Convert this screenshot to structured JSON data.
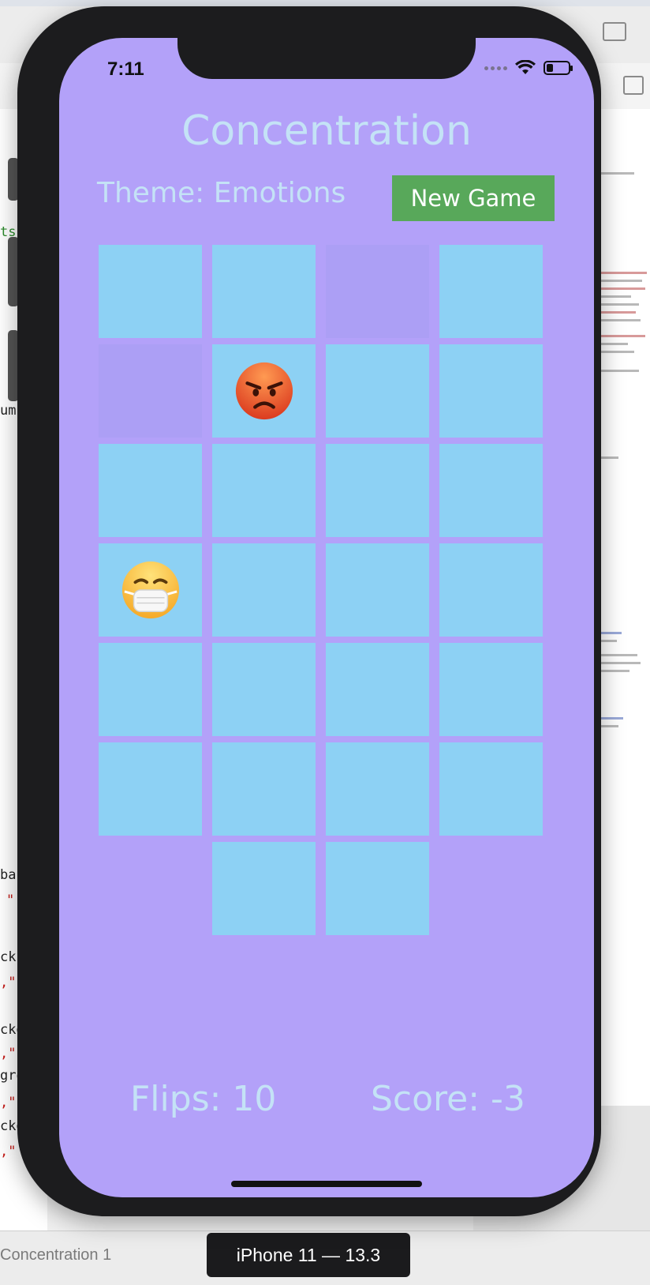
{
  "xcode": {
    "scheme_label": "Concentration 1",
    "device_label": "iPhone 11 — 13.3",
    "code_fragments": [
      "ts",
      "umb",
      "ba",
      "\"",
      "ck",
      ",\"",
      "ckg",
      ",\"",
      "gro",
      ",\"",
      "ckg",
      ",\""
    ]
  },
  "status_bar": {
    "time": "7:11"
  },
  "game": {
    "title": "Concentration",
    "theme_label": "Theme: Emotions",
    "new_game_label": "New Game",
    "flips_label": "Flips: 10",
    "score_label": "Score: -3"
  },
  "cards": [
    {
      "state": "face-down",
      "emoji": ""
    },
    {
      "state": "face-down",
      "emoji": ""
    },
    {
      "state": "matched",
      "emoji": ""
    },
    {
      "state": "face-down",
      "emoji": ""
    },
    {
      "state": "matched",
      "emoji": ""
    },
    {
      "state": "face-up",
      "emoji": "angry-face"
    },
    {
      "state": "face-down",
      "emoji": ""
    },
    {
      "state": "face-down",
      "emoji": ""
    },
    {
      "state": "face-down",
      "emoji": ""
    },
    {
      "state": "face-down",
      "emoji": ""
    },
    {
      "state": "face-down",
      "emoji": ""
    },
    {
      "state": "face-down",
      "emoji": ""
    },
    {
      "state": "face-up",
      "emoji": "face-with-medical-mask"
    },
    {
      "state": "face-down",
      "emoji": ""
    },
    {
      "state": "face-down",
      "emoji": ""
    },
    {
      "state": "face-down",
      "emoji": ""
    },
    {
      "state": "face-down",
      "emoji": ""
    },
    {
      "state": "face-down",
      "emoji": ""
    },
    {
      "state": "face-down",
      "emoji": ""
    },
    {
      "state": "face-down",
      "emoji": ""
    },
    {
      "state": "face-down",
      "emoji": ""
    },
    {
      "state": "face-down",
      "emoji": ""
    },
    {
      "state": "face-down",
      "emoji": ""
    },
    {
      "state": "face-down",
      "emoji": ""
    },
    {
      "state": "face-down",
      "emoji": ""
    },
    {
      "state": "face-down",
      "emoji": ""
    }
  ],
  "colors": {
    "background": "#b3a1f9",
    "card_back": "#8dd1f4",
    "card_matched": "#ac9ff5",
    "text": "#c4e2f6",
    "button": "#58a85a"
  }
}
